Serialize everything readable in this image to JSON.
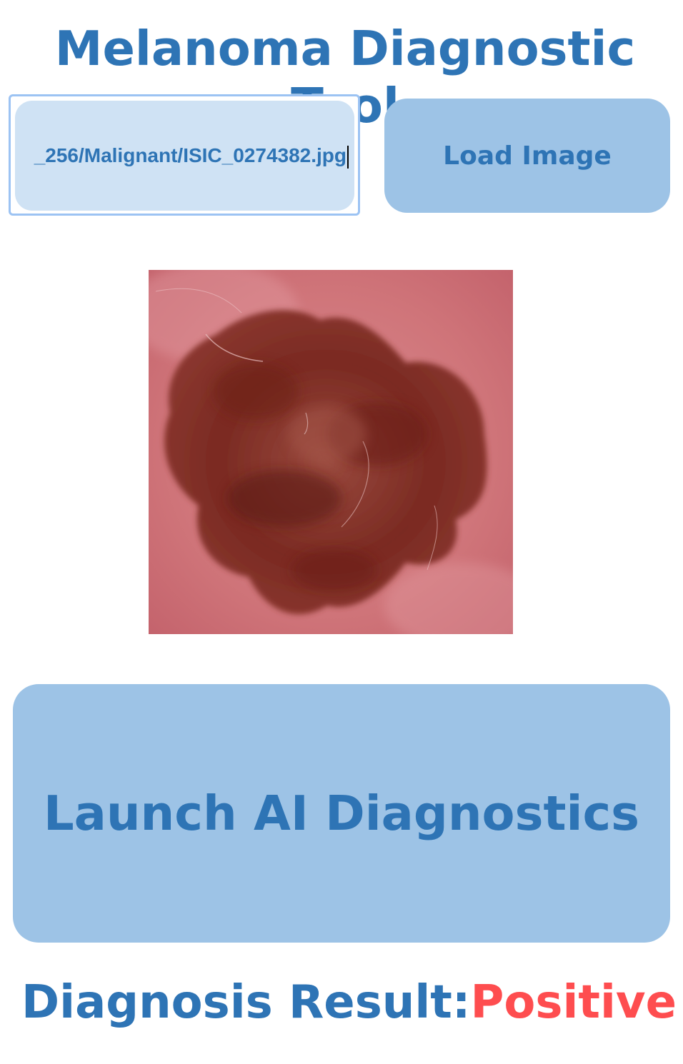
{
  "app": {
    "title": "Melanoma Diagnostic Tool"
  },
  "file_input": {
    "value": "_256/Malignant/ISIC_0274382.jpg"
  },
  "buttons": {
    "load_label": "Load Image",
    "launch_label": "Launch AI Diagnostics"
  },
  "result": {
    "label": "Diagnosis Result:",
    "value": "Positive"
  },
  "colors": {
    "accent": "#2e74b5",
    "button_bg": "#9dc3e6",
    "input_bg": "#cfe2f4",
    "input_focus_border": "#9cc3f3",
    "positive": "#fe4d4f"
  },
  "icons": {
    "lesion_image": "dermoscopy-lesion-image"
  }
}
